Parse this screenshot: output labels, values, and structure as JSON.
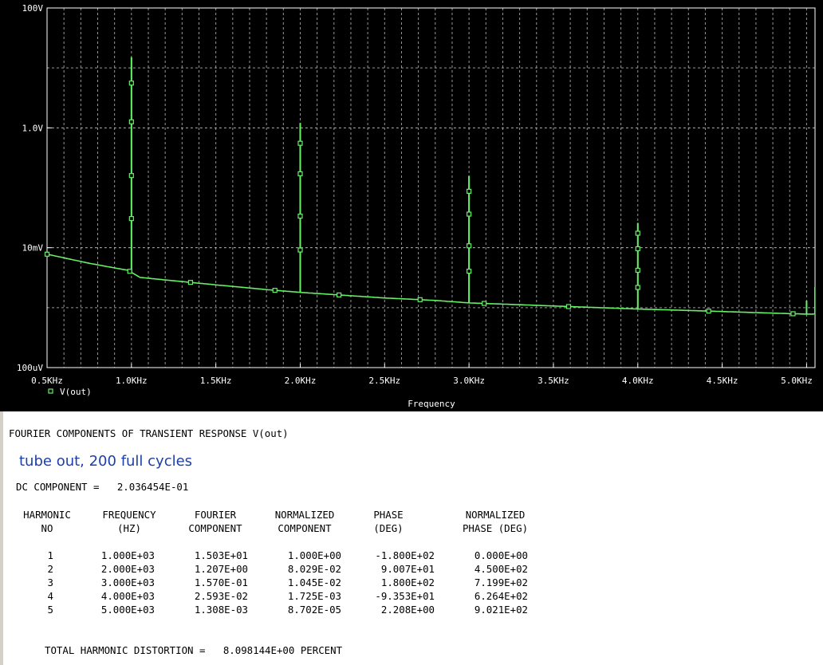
{
  "plot": {
    "colors": {
      "background": "#000000",
      "trace": "#66f066",
      "grid": "#c8c8c8",
      "text": "#ffffff"
    },
    "legend_label": "V(out)",
    "xlabel": "Frequency",
    "y_ticks": [
      "100V",
      "1.0V",
      "10mV",
      "100uV"
    ],
    "x_ticks": [
      "0.5KHz",
      "1.0KHz",
      "1.5KHz",
      "2.0KHz",
      "2.5KHz",
      "3.0KHz",
      "3.5KHz",
      "4.0KHz",
      "4.5KHz",
      "5.0KHz"
    ]
  },
  "chart_data": {
    "type": "line",
    "title": "",
    "xlabel": "Frequency",
    "ylabel": "",
    "x_unit": "Hz",
    "y_unit": "V",
    "y_scale": "log",
    "xlim": [
      500,
      5050
    ],
    "ylim": [
      0.0001,
      100
    ],
    "grid": true,
    "legend": "bottom-left",
    "series": [
      {
        "name": "V(out)",
        "floor": {
          "x": [
            500,
            750,
            900,
            980,
            1050,
            1200,
            1500,
            1800,
            2000,
            2200,
            2500,
            2800,
            3000,
            3300,
            3600,
            4000,
            4400,
            4800,
            5000
          ],
          "y": [
            0.0078,
            0.0055,
            0.0046,
            0.0042,
            0.0032,
            0.0029,
            0.0024,
            0.002,
            0.0018,
            0.00165,
            0.00145,
            0.00132,
            0.0012,
            0.00112,
            0.00104,
            0.00095,
            0.00088,
            0.00081,
            0.00078
          ]
        },
        "peaks": {
          "x": [
            1000,
            2000,
            3000,
            4000,
            5000
          ],
          "y": [
            15.03,
            1.207,
            0.157,
            0.02593,
            0.001308
          ]
        }
      }
    ]
  },
  "report": {
    "title": "FOURIER COMPONENTS OF TRANSIENT RESPONSE V(out)",
    "note": "tube out, 200 full cycles",
    "dc_label": "DC COMPONENT =",
    "dc_value": "2.036454E-01",
    "headers": [
      [
        "HARMONIC",
        "NO"
      ],
      [
        "FREQUENCY",
        "(HZ)"
      ],
      [
        "FOURIER",
        "COMPONENT"
      ],
      [
        "NORMALIZED",
        "COMPONENT"
      ],
      [
        "PHASE",
        "(DEG)"
      ],
      [
        "NORMALIZED",
        "PHASE (DEG)"
      ]
    ],
    "rows": [
      [
        "1",
        "1.000E+03",
        "1.503E+01",
        "1.000E+00",
        "-1.800E+02",
        "0.000E+00"
      ],
      [
        "2",
        "2.000E+03",
        "1.207E+00",
        "8.029E-02",
        "9.007E+01",
        "4.500E+02"
      ],
      [
        "3",
        "3.000E+03",
        "1.570E-01",
        "1.045E-02",
        "1.800E+02",
        "7.199E+02"
      ],
      [
        "4",
        "4.000E+03",
        "2.593E-02",
        "1.725E-03",
        "-9.353E+01",
        "6.264E+02"
      ],
      [
        "5",
        "5.000E+03",
        "1.308E-03",
        "8.702E-05",
        "2.208E+00",
        "9.021E+02"
      ]
    ],
    "thd_label": "TOTAL HARMONIC DISTORTION =",
    "thd_value": "8.098144E+00",
    "thd_unit": "PERCENT"
  }
}
